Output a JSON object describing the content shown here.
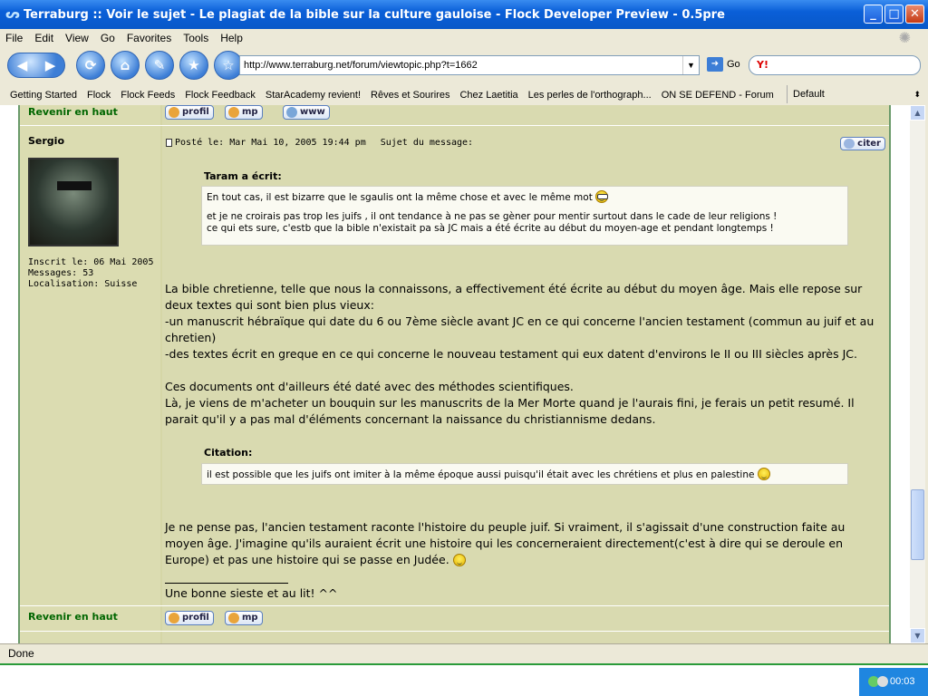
{
  "window": {
    "title": "Terraburg :: Voir le sujet - Le plagiat de la bible sur la culture gauloise - Flock Developer Preview - 0.5pre",
    "minimize": "_",
    "maximize": "□",
    "close": "✕"
  },
  "menu": [
    "File",
    "Edit",
    "View",
    "Go",
    "Favorites",
    "Tools",
    "Help"
  ],
  "toolbar": {
    "url": "http://www.terraburg.net/forum/viewtopic.php?t=1662",
    "go_label": "Go",
    "search_logo": "Y!"
  },
  "bookmarks": {
    "items": [
      "Getting Started",
      "Flock",
      "Flock Feeds",
      "Flock Feedback",
      "StarAcademy revient!",
      "Rêves et Sourires",
      "Chez Laetitia",
      "Les perles de l'orthograph...",
      "ON SE DEFEND - Forum"
    ],
    "selector": "Default"
  },
  "forum": {
    "back_to_top": "Revenir en haut",
    "buttons": {
      "profil": "profil",
      "mp": "mp",
      "www": "www",
      "citer": "citer"
    },
    "post": {
      "author": "Sergio",
      "inscrit": "Inscrit le: 06 Mai 2005",
      "messages": "Messages: 53",
      "localisation": "Localisation: Suisse",
      "posted": "Posté le: Mar Mai 10, 2005 19:44 pm",
      "subject": "Sujet du message:",
      "quote1_author": "Taram a écrit:",
      "quote1_line1": "En tout cas, il est bizarre que le sgaulis ont la même chose et avec le même mot",
      "quote1_line2": "et je ne croirais pas trop les juifs , il ont tendance à ne pas se gèner pour mentir surtout dans le cade de leur religions !",
      "quote1_line3": "ce qui ets sure, c'estb que la bible n'existait pa sà JC mais a été écrite au début du moyen-age et pendant longtemps !",
      "body": [
        "La bible chretienne, telle que nous la connaissons, a effectivement été écrite au début du moyen âge. Mais elle repose sur",
        "deux textes qui sont bien plus vieux:",
        "-un manuscrit hébraïque qui date du 6 ou 7ème siècle avant JC en ce qui concerne l'ancien testament (commun au juif et au",
        "chretien)",
        "-des textes écrit en greque en ce qui concerne le nouveau testament qui eux datent d'environs le II ou III siècles après JC.",
        "Ces documents ont d'ailleurs été daté avec des méthodes scientifiques.",
        "Là, je viens de m'acheter un bouquin sur les manuscrits de la Mer Morte quand je l'aurais fini, je ferais un petit resumé. Il",
        "parait qu'il y a pas mal d'éléments concernant la naissance du christiannisme dedans."
      ],
      "citation_label": "Citation:",
      "citation_text": "il est possible que les juifs ont imiter à la même époque aussi puisqu'il était avec les chrétiens et plus en palestine",
      "reply": [
        "Je ne pense pas, l'ancien testament raconte l'histoire du peuple juif. Si vraiment, il s'agissait d'une construction faite au",
        "moyen âge. J'imagine qu'ils auraient écrit une histoire qui les concerneraient directement(c'est à dire qui se deroule en",
        "Europe) et pas une histoire qui se passe en Judée."
      ],
      "signature": "Une bonne sieste et au lit! ^^"
    }
  },
  "status": "Done",
  "clock": "00:03"
}
